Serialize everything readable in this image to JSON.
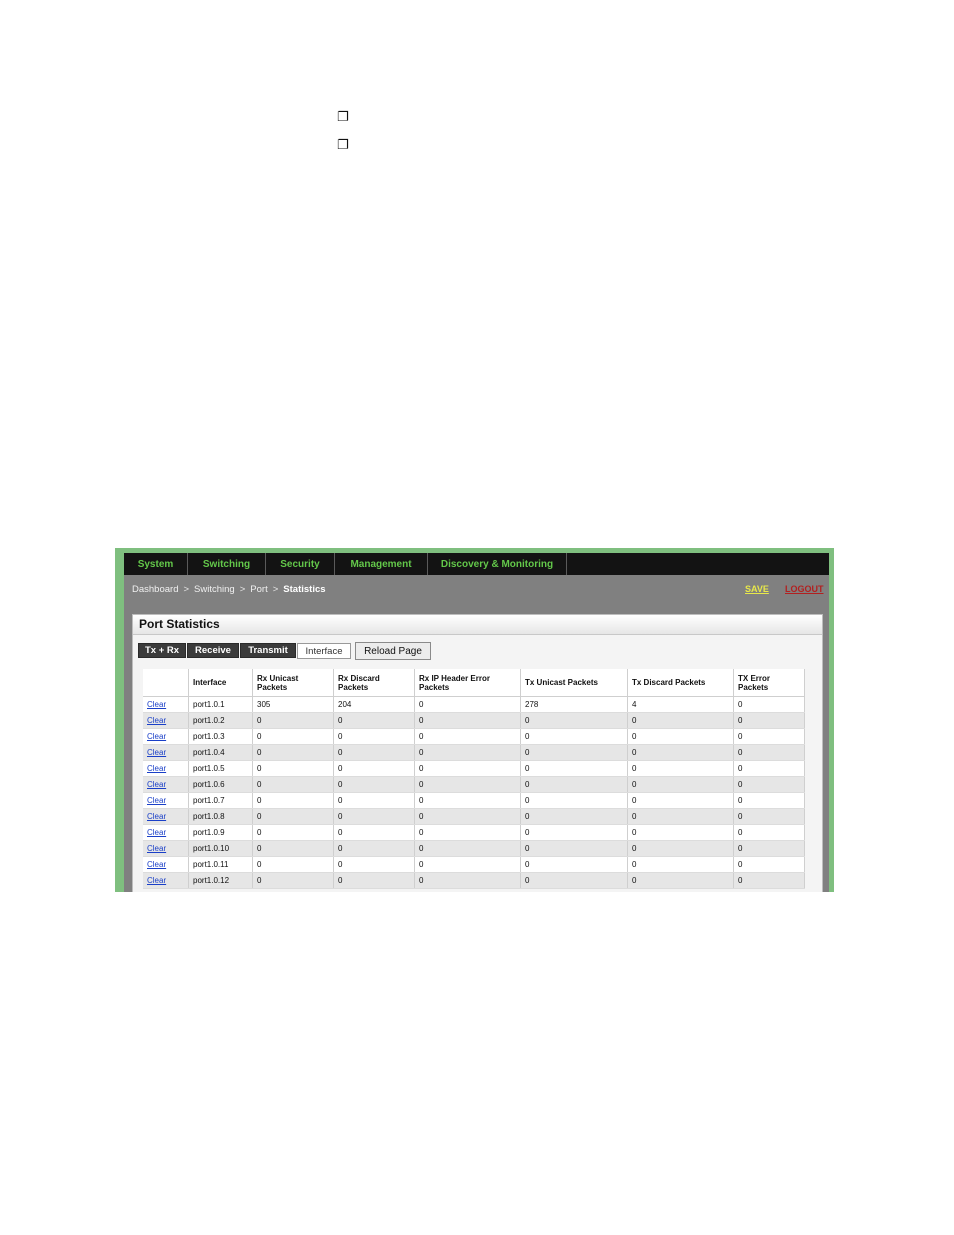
{
  "bullets": [
    "❐",
    "❐"
  ],
  "nav": {
    "items": [
      "System",
      "Switching",
      "Security",
      "Management",
      "Discovery & Monitoring"
    ]
  },
  "breadcrumb": {
    "items": [
      "Dashboard",
      "Switching",
      "Port",
      "Statistics"
    ],
    "separator": ">"
  },
  "actions": {
    "save": "SAVE",
    "logout": "LOGOUT"
  },
  "panel": {
    "title": "Port Statistics"
  },
  "tabs": [
    "Tx + Rx",
    "Receive",
    "Transmit",
    "Interface"
  ],
  "active_tab": "Interface",
  "reload_label": "Reload Page",
  "table": {
    "headers": [
      "",
      "Interface",
      "Rx Unicast Packets",
      "Rx Discard Packets",
      "Rx IP Header Error Packets",
      "Tx Unicast Packets",
      "Tx Discard Packets",
      "TX Error Packets"
    ],
    "rows": [
      [
        "Clear",
        "port1.0.1",
        "305",
        "204",
        "0",
        "278",
        "4",
        "0"
      ],
      [
        "Clear",
        "port1.0.2",
        "0",
        "0",
        "0",
        "0",
        "0",
        "0"
      ],
      [
        "Clear",
        "port1.0.3",
        "0",
        "0",
        "0",
        "0",
        "0",
        "0"
      ],
      [
        "Clear",
        "port1.0.4",
        "0",
        "0",
        "0",
        "0",
        "0",
        "0"
      ],
      [
        "Clear",
        "port1.0.5",
        "0",
        "0",
        "0",
        "0",
        "0",
        "0"
      ],
      [
        "Clear",
        "port1.0.6",
        "0",
        "0",
        "0",
        "0",
        "0",
        "0"
      ],
      [
        "Clear",
        "port1.0.7",
        "0",
        "0",
        "0",
        "0",
        "0",
        "0"
      ],
      [
        "Clear",
        "port1.0.8",
        "0",
        "0",
        "0",
        "0",
        "0",
        "0"
      ],
      [
        "Clear",
        "port1.0.9",
        "0",
        "0",
        "0",
        "0",
        "0",
        "0"
      ],
      [
        "Clear",
        "port1.0.10",
        "0",
        "0",
        "0",
        "0",
        "0",
        "0"
      ],
      [
        "Clear",
        "port1.0.11",
        "0",
        "0",
        "0",
        "0",
        "0",
        "0"
      ],
      [
        "Clear",
        "port1.0.12",
        "0",
        "0",
        "0",
        "0",
        "0",
        "0"
      ]
    ]
  },
  "colors": {
    "nav_text": "#63c84a",
    "save": "#e8e84a",
    "logout": "#b22020",
    "link": "#1a3fc8"
  }
}
